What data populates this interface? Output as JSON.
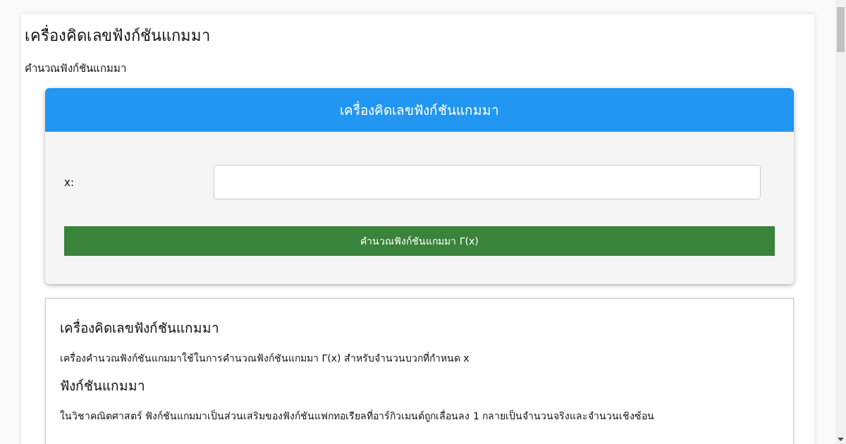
{
  "page_title": "เครื่องคิดเลขฟังก์ชันแกมมา",
  "subtitle": "คำนวณฟังก์ชันแกมมา",
  "calculator": {
    "header": "เครื่องคิดเลขฟังก์ชันแกมมา",
    "fields": [
      {
        "label": "x:"
      }
    ],
    "button": "คำนวณฟังก์ชันแกมมา Γ(x)"
  },
  "article": [
    {
      "kind": "heading",
      "text": "เครื่องคิดเลขฟังก์ชันแกมมา"
    },
    {
      "kind": "paragraph",
      "text": "เครื่องคำนวณฟังก์ชันแกมมาใช้ในการคำนวณฟังก์ชันแกมมา Γ(x) สำหรับจำนวนบวกที่กำหนด x"
    },
    {
      "kind": "heading",
      "text": "ฟังก์ชันแกมมา"
    },
    {
      "kind": "paragraph",
      "text": "ในวิชาคณิตศาสตร์ ฟังก์ชันแกมมาเป็นส่วนเสริมของฟังก์ชันแฟกทอเรียลที่อาร์กิวเมนต์ถูกเลื่อนลง 1 กลายเป็นจำนวนจริงและจำนวนเชิงซ้อน"
    }
  ]
}
